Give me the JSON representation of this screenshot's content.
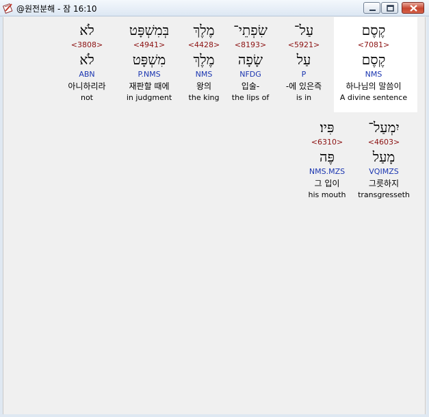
{
  "window": {
    "title": "@원전분해 - 잠 16:10",
    "icons": {
      "app": "notebook-pen-icon",
      "minimize": "minimize-icon",
      "maximize": "maximize-icon",
      "close": "close-icon"
    }
  },
  "rows": [
    {
      "words": [
        {
          "hebrew": "לֹא",
          "strongs": "<3808>",
          "lemma": "לֹא",
          "morph": "ABN",
          "korean": "아니하리라",
          "english": "not"
        },
        {
          "hebrew": "בְּמִשְׁפָּט",
          "strongs": "<4941>",
          "lemma": "מִשְׁפָּט",
          "morph": "P.NMS",
          "korean": "재판할 때에",
          "english": "in judgment"
        },
        {
          "hebrew": "מֶלֶךְ",
          "strongs": "<4428>",
          "lemma": "מֶלֶךְ",
          "morph": "NMS",
          "korean": "왕의",
          "english": "the king"
        },
        {
          "hebrew": "שִׂפְתֵי־",
          "strongs": "<8193>",
          "lemma": "שָׂפָה",
          "morph": "NFDG",
          "korean": "입술-",
          "english": "the lips of"
        },
        {
          "hebrew": "עַל־",
          "strongs": "<5921>",
          "lemma": "עַל",
          "morph": "P",
          "korean": "-에 있은즉",
          "english": "is in"
        },
        {
          "hebrew": "קֶסֶם",
          "strongs": "<7081>",
          "lemma": "קֶסֶם",
          "morph": "NMS",
          "korean": "하나님의 말씀이",
          "english": "A divine sentence",
          "selected": true
        }
      ]
    },
    {
      "words": [
        {
          "hebrew": "פִּיו׃",
          "strongs": "<6310>",
          "lemma": "פֶּה",
          "morph": "NMS.MZS",
          "korean": "그 입이",
          "english": "his mouth"
        },
        {
          "hebrew": "יִמְעַל־",
          "strongs": "<4603>",
          "lemma": "מָעַל",
          "morph": "VQIMZS",
          "korean": "그릇하지",
          "english": "transgresseth"
        }
      ]
    }
  ]
}
